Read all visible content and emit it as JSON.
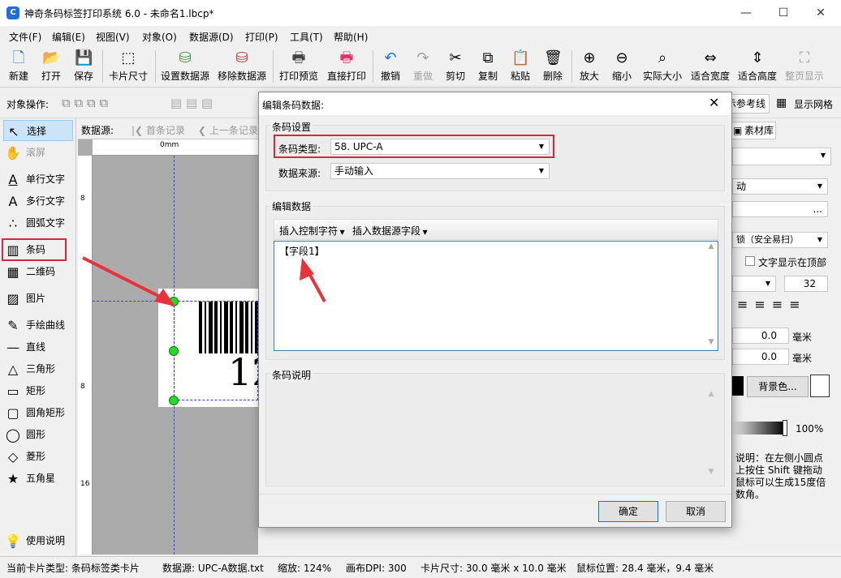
{
  "app": {
    "icon_letter": "C",
    "title": "神奇条码标签打印系统 6.0 - 未命名1.lbcp*",
    "minimize": "—",
    "maximize": "☐",
    "close": "✕"
  },
  "menu": [
    "文件(F)",
    "编辑(E)",
    "视图(V)",
    "对象(O)",
    "数据源(D)",
    "打印(P)",
    "工具(T)",
    "帮助(H)"
  ],
  "toolbar": [
    {
      "label": "新建",
      "icon": "new-icon",
      "glyph": "🗋"
    },
    {
      "label": "打开",
      "icon": "open-icon",
      "glyph": "📂"
    },
    {
      "label": "保存",
      "icon": "save-icon",
      "glyph": "💾"
    },
    {
      "label": "卡片尺寸",
      "icon": "card-size-icon",
      "glyph": "⬚"
    },
    {
      "label": "设置数据源",
      "icon": "database-icon",
      "glyph": "⛁"
    },
    {
      "label": "移除数据源",
      "icon": "database-remove-icon",
      "glyph": "⛁"
    },
    {
      "label": "打印预览",
      "icon": "print-preview-icon",
      "glyph": "🖶"
    },
    {
      "label": "直接打印",
      "icon": "print-icon",
      "glyph": "🖶"
    },
    {
      "label": "撤销",
      "icon": "undo-icon",
      "glyph": "↶"
    },
    {
      "label": "重做",
      "icon": "redo-icon",
      "glyph": "↷"
    },
    {
      "label": "剪切",
      "icon": "cut-icon",
      "glyph": "✂"
    },
    {
      "label": "复制",
      "icon": "copy-icon",
      "glyph": "⧉"
    },
    {
      "label": "粘贴",
      "icon": "paste-icon",
      "glyph": "📋"
    },
    {
      "label": "删除",
      "icon": "delete-icon",
      "glyph": "🗑"
    },
    {
      "label": "放大",
      "icon": "zoom-in-icon",
      "glyph": "⊕"
    },
    {
      "label": "缩小",
      "icon": "zoom-out-icon",
      "glyph": "⊖"
    },
    {
      "label": "实际大小",
      "icon": "actual-size-icon",
      "glyph": "⌕"
    },
    {
      "label": "适合宽度",
      "icon": "fit-width-icon",
      "glyph": "⇔"
    },
    {
      "label": "适合高度",
      "icon": "fit-height-icon",
      "glyph": "⇕"
    },
    {
      "label": "整页显示",
      "icon": "full-page-icon",
      "glyph": "⛶"
    }
  ],
  "objbar": {
    "label": "对象操作:",
    "ref_line": "示参考线",
    "grid": "显示网格"
  },
  "tools": [
    {
      "label": "选择",
      "icon": "pointer-icon",
      "glyph": "↖"
    },
    {
      "label": "滚屏",
      "icon": "hand-icon",
      "glyph": "✋"
    },
    {
      "label": "单行文字",
      "icon": "single-text-icon",
      "glyph": "A"
    },
    {
      "label": "多行文字",
      "icon": "multi-text-icon",
      "glyph": "A"
    },
    {
      "label": "圆弧文字",
      "icon": "arc-text-icon",
      "glyph": "∴"
    },
    {
      "label": "条码",
      "icon": "barcode-icon",
      "glyph": "▥"
    },
    {
      "label": "二维码",
      "icon": "qrcode-icon",
      "glyph": "▦"
    },
    {
      "label": "图片",
      "icon": "image-icon",
      "glyph": "▨"
    },
    {
      "label": "手绘曲线",
      "icon": "pen-icon",
      "glyph": "✎"
    },
    {
      "label": "直线",
      "icon": "line-icon",
      "glyph": "—"
    },
    {
      "label": "三角形",
      "icon": "triangle-icon",
      "glyph": "△"
    },
    {
      "label": "矩形",
      "icon": "rectangle-icon",
      "glyph": "▭"
    },
    {
      "label": "圆角矩形",
      "icon": "rounded-rect-icon",
      "glyph": "▢"
    },
    {
      "label": "圆形",
      "icon": "circle-icon",
      "glyph": "◯"
    },
    {
      "label": "菱形",
      "icon": "diamond-icon",
      "glyph": "◇"
    },
    {
      "label": "五角星",
      "icon": "star-icon",
      "glyph": "★"
    },
    {
      "label": "使用说明",
      "icon": "bulb-icon",
      "glyph": "💡"
    }
  ],
  "nav": {
    "datasource": "数据源:",
    "first": "首条记录",
    "prev": "上一条记录"
  },
  "ruler": {
    "origin": "0mm",
    "v1": "8",
    "v2": "8",
    "v3": "16"
  },
  "label_preview": {
    "digits": "12"
  },
  "right": {
    "tab": "素材库",
    "mode": "动",
    "scan_mode": "锁（安全易扫）",
    "text_top": "文字显示在顶部",
    "font_size": "32",
    "val1": "0.0",
    "unit1": "毫米",
    "val2": "0.0",
    "unit2": "毫米",
    "bg_color": "背景色...",
    "opacity": "100%",
    "help": "说明：在左侧小圆点上按住 Shift 键拖动鼠标可以生成15度倍数角。"
  },
  "dialog": {
    "title": "编辑条码数据:",
    "section_settings": "条码设置",
    "type_label": "条码类型:",
    "type_value": "58. UPC-A",
    "source_label": "数据来源:",
    "source_value": "手动输入",
    "section_edit": "编辑数据",
    "insert_ctrl": "插入控制字符",
    "insert_field": "插入数据源字段",
    "content": "【字段1】",
    "section_desc": "条码说明",
    "ok": "确定",
    "cancel": "取消"
  },
  "status": {
    "card_type": "当前卡片类型: 条码标签类卡片",
    "datasource": "数据源: UPC-A数据.txt",
    "zoom": "缩放: 124%",
    "dpi": "画布DPI: 300",
    "size": "卡片尺寸: 30.0 毫米 x 10.0 毫米",
    "mouse": "鼠标位置: 28.4 毫米，9.4 毫米"
  },
  "colors": {
    "accent": "#d9263a",
    "arrow": "#e8333d",
    "handle": "#22dd22",
    "guide": "#3a3aff"
  }
}
